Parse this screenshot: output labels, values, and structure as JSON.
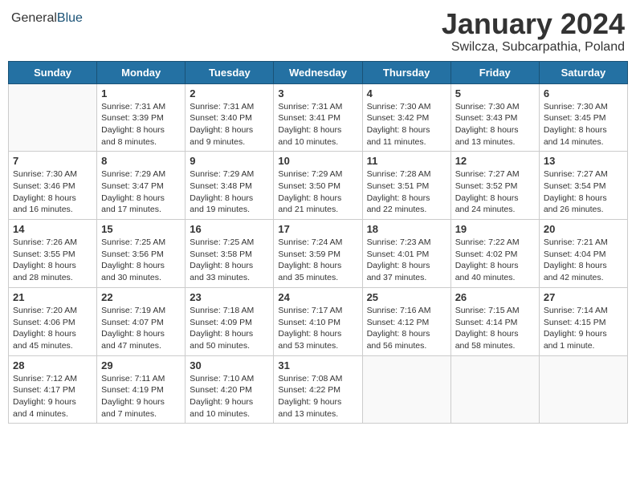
{
  "header": {
    "logo": {
      "general": "General",
      "blue": "Blue"
    },
    "title": "January 2024",
    "location": "Swilcza, Subcarpathia, Poland"
  },
  "weekdays": [
    "Sunday",
    "Monday",
    "Tuesday",
    "Wednesday",
    "Thursday",
    "Friday",
    "Saturday"
  ],
  "weeks": [
    [
      {
        "day": null
      },
      {
        "day": "1",
        "sunrise": "7:31 AM",
        "sunset": "3:39 PM",
        "daylight": "8 hours and 8 minutes."
      },
      {
        "day": "2",
        "sunrise": "7:31 AM",
        "sunset": "3:40 PM",
        "daylight": "8 hours and 9 minutes."
      },
      {
        "day": "3",
        "sunrise": "7:31 AM",
        "sunset": "3:41 PM",
        "daylight": "8 hours and 10 minutes."
      },
      {
        "day": "4",
        "sunrise": "7:30 AM",
        "sunset": "3:42 PM",
        "daylight": "8 hours and 11 minutes."
      },
      {
        "day": "5",
        "sunrise": "7:30 AM",
        "sunset": "3:43 PM",
        "daylight": "8 hours and 13 minutes."
      },
      {
        "day": "6",
        "sunrise": "7:30 AM",
        "sunset": "3:45 PM",
        "daylight": "8 hours and 14 minutes."
      }
    ],
    [
      {
        "day": "7",
        "sunrise": "7:30 AM",
        "sunset": "3:46 PM",
        "daylight": "8 hours and 16 minutes."
      },
      {
        "day": "8",
        "sunrise": "7:29 AM",
        "sunset": "3:47 PM",
        "daylight": "8 hours and 17 minutes."
      },
      {
        "day": "9",
        "sunrise": "7:29 AM",
        "sunset": "3:48 PM",
        "daylight": "8 hours and 19 minutes."
      },
      {
        "day": "10",
        "sunrise": "7:29 AM",
        "sunset": "3:50 PM",
        "daylight": "8 hours and 21 minutes."
      },
      {
        "day": "11",
        "sunrise": "7:28 AM",
        "sunset": "3:51 PM",
        "daylight": "8 hours and 22 minutes."
      },
      {
        "day": "12",
        "sunrise": "7:27 AM",
        "sunset": "3:52 PM",
        "daylight": "8 hours and 24 minutes."
      },
      {
        "day": "13",
        "sunrise": "7:27 AM",
        "sunset": "3:54 PM",
        "daylight": "8 hours and 26 minutes."
      }
    ],
    [
      {
        "day": "14",
        "sunrise": "7:26 AM",
        "sunset": "3:55 PM",
        "daylight": "8 hours and 28 minutes."
      },
      {
        "day": "15",
        "sunrise": "7:25 AM",
        "sunset": "3:56 PM",
        "daylight": "8 hours and 30 minutes."
      },
      {
        "day": "16",
        "sunrise": "7:25 AM",
        "sunset": "3:58 PM",
        "daylight": "8 hours and 33 minutes."
      },
      {
        "day": "17",
        "sunrise": "7:24 AM",
        "sunset": "3:59 PM",
        "daylight": "8 hours and 35 minutes."
      },
      {
        "day": "18",
        "sunrise": "7:23 AM",
        "sunset": "4:01 PM",
        "daylight": "8 hours and 37 minutes."
      },
      {
        "day": "19",
        "sunrise": "7:22 AM",
        "sunset": "4:02 PM",
        "daylight": "8 hours and 40 minutes."
      },
      {
        "day": "20",
        "sunrise": "7:21 AM",
        "sunset": "4:04 PM",
        "daylight": "8 hours and 42 minutes."
      }
    ],
    [
      {
        "day": "21",
        "sunrise": "7:20 AM",
        "sunset": "4:06 PM",
        "daylight": "8 hours and 45 minutes."
      },
      {
        "day": "22",
        "sunrise": "7:19 AM",
        "sunset": "4:07 PM",
        "daylight": "8 hours and 47 minutes."
      },
      {
        "day": "23",
        "sunrise": "7:18 AM",
        "sunset": "4:09 PM",
        "daylight": "8 hours and 50 minutes."
      },
      {
        "day": "24",
        "sunrise": "7:17 AM",
        "sunset": "4:10 PM",
        "daylight": "8 hours and 53 minutes."
      },
      {
        "day": "25",
        "sunrise": "7:16 AM",
        "sunset": "4:12 PM",
        "daylight": "8 hours and 56 minutes."
      },
      {
        "day": "26",
        "sunrise": "7:15 AM",
        "sunset": "4:14 PM",
        "daylight": "8 hours and 58 minutes."
      },
      {
        "day": "27",
        "sunrise": "7:14 AM",
        "sunset": "4:15 PM",
        "daylight": "9 hours and 1 minute."
      }
    ],
    [
      {
        "day": "28",
        "sunrise": "7:12 AM",
        "sunset": "4:17 PM",
        "daylight": "9 hours and 4 minutes."
      },
      {
        "day": "29",
        "sunrise": "7:11 AM",
        "sunset": "4:19 PM",
        "daylight": "9 hours and 7 minutes."
      },
      {
        "day": "30",
        "sunrise": "7:10 AM",
        "sunset": "4:20 PM",
        "daylight": "9 hours and 10 minutes."
      },
      {
        "day": "31",
        "sunrise": "7:08 AM",
        "sunset": "4:22 PM",
        "daylight": "9 hours and 13 minutes."
      },
      {
        "day": null
      },
      {
        "day": null
      },
      {
        "day": null
      }
    ]
  ]
}
